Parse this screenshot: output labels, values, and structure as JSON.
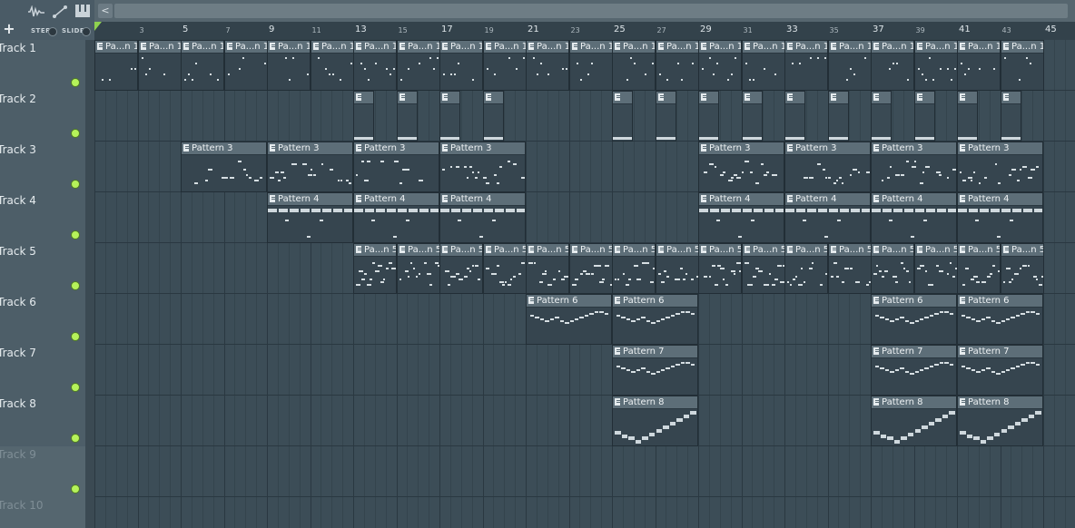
{
  "toolbar": {
    "add_label": "+",
    "step_label": "STEP",
    "slide_label": "SLIDE",
    "icons": [
      "waveform-icon",
      "automation-icon",
      "piano-roll-icon"
    ]
  },
  "scrollbar": {
    "arrow": "<"
  },
  "ruler": {
    "labels": [
      "3",
      "5",
      "7",
      "9",
      "11",
      "13",
      "15",
      "17",
      "19",
      "21",
      "23",
      "25",
      "27",
      "29",
      "31",
      "33",
      "35",
      "37",
      "39",
      "41",
      "43",
      "45"
    ]
  },
  "tracks": [
    {
      "name": "Track 1",
      "has_content": true
    },
    {
      "name": "Track 2",
      "has_content": true
    },
    {
      "name": "Track 3",
      "has_content": true
    },
    {
      "name": "Track 4",
      "has_content": true
    },
    {
      "name": "Track 5",
      "has_content": true
    },
    {
      "name": "Track 6",
      "has_content": true
    },
    {
      "name": "Track 7",
      "has_content": true
    },
    {
      "name": "Track 8",
      "has_content": true
    },
    {
      "name": "Track 9",
      "has_content": false
    },
    {
      "name": "Track 10",
      "has_content": false
    }
  ],
  "clip_groups": [
    {
      "track": 1,
      "label": "Pa...n 1",
      "style": "dots",
      "bars": [
        1,
        3,
        5,
        7,
        9,
        11,
        13,
        15,
        17,
        19,
        21,
        23,
        25,
        27,
        29,
        31,
        33,
        35,
        37,
        39,
        41,
        43
      ],
      "len": 2
    },
    {
      "track": 2,
      "label": "",
      "style": "line",
      "bars": [
        13,
        15,
        17,
        19
      ],
      "len": 1
    },
    {
      "track": 2,
      "label": "",
      "style": "line",
      "bars": [
        25,
        27,
        29,
        31,
        33,
        35,
        37,
        39,
        41,
        43
      ],
      "len": 1
    },
    {
      "track": 3,
      "label": "Pattern 3",
      "style": "melody",
      "bars": [
        5,
        9,
        13,
        17,
        29,
        33,
        37,
        41
      ],
      "len": 4
    },
    {
      "track": 4,
      "label": "Pattern 4",
      "style": "drum",
      "bars": [
        9,
        13,
        17,
        29,
        33,
        37,
        41
      ],
      "len": 4
    },
    {
      "track": 5,
      "label": "Pa...n 5",
      "style": "dense",
      "bars": [
        13,
        15,
        17,
        19,
        21,
        23,
        25,
        27,
        29,
        31,
        33,
        35,
        37,
        39,
        41,
        43
      ],
      "len": 2
    },
    {
      "track": 6,
      "label": "Pattern 6",
      "style": "arc",
      "bars": [
        21,
        25,
        37,
        41
      ],
      "len": 4
    },
    {
      "track": 7,
      "label": "Pattern 7",
      "style": "arc",
      "bars": [
        25,
        37,
        41
      ],
      "len": 4
    },
    {
      "track": 8,
      "label": "Pattern 8",
      "style": "steps",
      "bars": [
        25,
        37,
        41
      ],
      "len": 4
    }
  ],
  "colors": {
    "led": "#b6f25a",
    "playhead": "#8fd14f",
    "clip_head": "#5d6e78",
    "note": "#d6dee2"
  }
}
